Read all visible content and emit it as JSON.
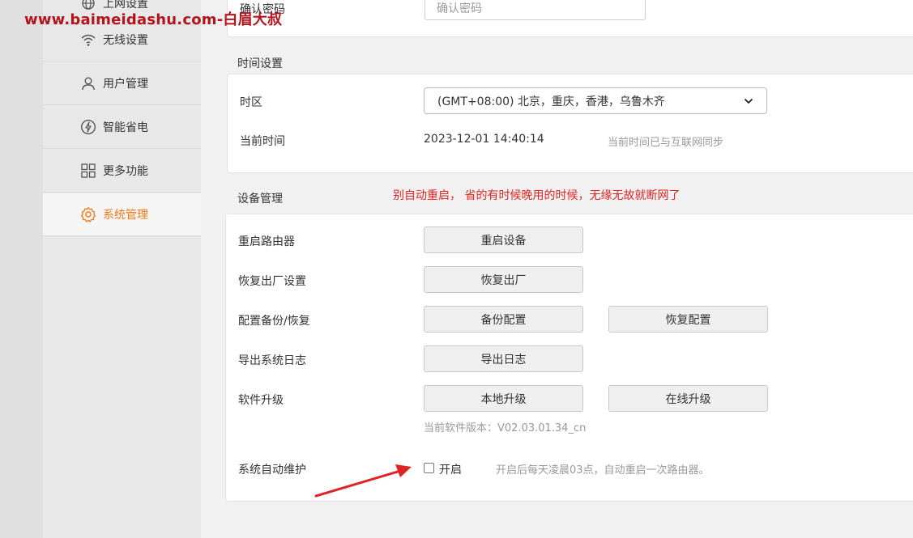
{
  "watermark": "www.baimeidashu.com-白眉大叔",
  "sidebar": {
    "items": [
      {
        "label": "上网设置",
        "icon": "globe-icon"
      },
      {
        "label": "无线设置",
        "icon": "wifi-icon"
      },
      {
        "label": "用户管理",
        "icon": "user-icon"
      },
      {
        "label": "智能省电",
        "icon": "power-saving-icon"
      },
      {
        "label": "更多功能",
        "icon": "grid-icon"
      },
      {
        "label": "系统管理",
        "icon": "gear-icon"
      }
    ],
    "active_index": 5
  },
  "password_section": {
    "label": "确认密码",
    "input_placeholder": "确认密码"
  },
  "time_section": {
    "title": "时间设置",
    "timezone_label": "时区",
    "timezone_value": "(GMT+08:00) 北京，重庆，香港，乌鲁木齐",
    "current_time_label": "当前时间",
    "current_time_value": "2023-12-01 14:40:14",
    "sync_hint": "当前时间已与互联网同步"
  },
  "device_section": {
    "title": "设备管理",
    "annotation": "别自动重启， 省的有时候晚用的时候，无缘无故就断网了",
    "reboot_label": "重启路由器",
    "reboot_button": "重启设备",
    "factory_label": "恢复出厂设置",
    "factory_button": "恢复出厂",
    "backup_label": "配置备份/恢复",
    "backup_button": "备份配置",
    "restore_button": "恢复配置",
    "log_label": "导出系统日志",
    "log_button": "导出日志",
    "upgrade_label": "软件升级",
    "local_upgrade_button": "本地升级",
    "online_upgrade_button": "在线升级",
    "version_text": "当前软件版本：V02.03.01.34_cn",
    "auto_maint_label": "系统自动维护",
    "auto_maint_checkbox_label": "开启",
    "auto_maint_hint": "开启后每天凌晨03点，自动重启一次路由器。"
  },
  "colors": {
    "accent": "#f07a18",
    "annotation": "#e02424",
    "watermark": "#b3141c"
  }
}
